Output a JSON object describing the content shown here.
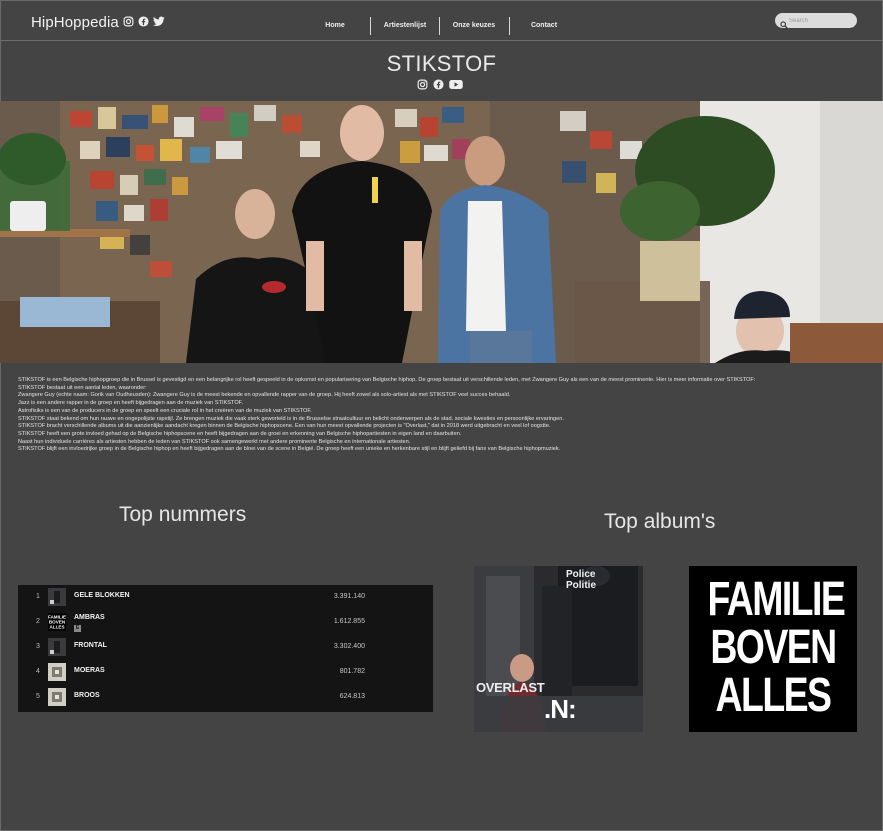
{
  "header": {
    "brand": "HipHoppedia",
    "social": [
      "instagram-icon",
      "facebook-icon",
      "twitter-icon"
    ],
    "nav": [
      {
        "label": "Home"
      },
      {
        "label": "Artiestenlijst"
      },
      {
        "label": "Onze keuzes"
      },
      {
        "label": "Contact"
      }
    ],
    "search": {
      "placeholder": "Search"
    }
  },
  "artist": {
    "name": "STIKSTOF",
    "social": [
      "instagram-icon",
      "facebook-icon",
      "youtube-icon"
    ]
  },
  "bio": [
    "STIKSTOF is een Belgische hiphopgroep die in Brussel is gevestigd en een belangrijke rol heeft gespeeld in de opkomst en popularisering van Belgische hiphop. De groep bestaat uit verschillende leden, met Zwangere Guy als een van de meest prominente. Hier is meer informatie over STIKSTOF:",
    "STIKSTOF bestaat uit een aantal leden, waaronder:",
    "Zwangere Guy (echte naam: Gorik van Oudheusden): Zwangere Guy is de meest bekende en opvallende rapper van de groep. Hij heeft zowel als solo-artiest als met STIKSTOF veel succes behaald.",
    "Jazz is een andere rapper in de groep en heeft bijgedragen aan de muziek van STIKSTOF.",
    "Astrofisiks is een van de producers in de groep en speelt een cruciale rol in het creëren van de muziek van STIKSTOF.",
    "STIKSTOF staat bekend om hun rauwe en ongepolijste rapstijl. Ze brengen muziek die vaak sterk geworteld is in de Brusselse straatcultuur en belicht onderwerpen als de stad, sociale kwesties en persoonlijke ervaringen.",
    "STIKSTOF bracht verschillende albums uit die aanzienlijke aandacht kregen binnen de Belgische hiphopscene. Een van hun meest opvallende projecten is \"Overlast,\" dat in 2018 werd uitgebracht en veel lof oogstte.",
    "STIKSTOF heeft een grote invloed gehad op de Belgische hiphopscene en heeft bijgedragen aan de groei en erkenning van Belgische hiphopartiesten in eigen land en daarbuiten.",
    "Naast hun individuele carrières als artiesten hebben de leden van STIKSTOF ook samengewerkt met andere prominente Belgische en internationale artiesten.",
    "STIKSTOF blijft een invloedrijke groep in de Belgische hiphop en heeft bijgedragen aan de bloei van de scene in België. De groep heeft een unieke en herkenbare stijl en blijft geliefd bij fans van Belgische hiphopmuziek."
  ],
  "top_tracks": {
    "title": "Top nummers",
    "items": [
      {
        "rank": "1",
        "title": "GELE BLOKKEN",
        "plays": "3.391.140",
        "explicit": false,
        "art": "dark"
      },
      {
        "rank": "2",
        "title": "AMBRAS",
        "plays": "1.612.855",
        "explicit": true,
        "badge": "E",
        "art": "familie"
      },
      {
        "rank": "3",
        "title": "FRONTAL",
        "plays": "3.302.400",
        "explicit": false,
        "art": "dark"
      },
      {
        "rank": "4",
        "title": "MOERAS",
        "plays": "801.782",
        "explicit": false,
        "art": "light"
      },
      {
        "rank": "5",
        "title": "BROOS",
        "plays": "624.813",
        "explicit": false,
        "art": "light"
      }
    ]
  },
  "top_albums": {
    "title": "Top album's",
    "items": [
      {
        "name": "overlast",
        "cover_text": "OVERLAST",
        "sign_line1": "Police",
        "sign_line2": "Politie",
        "logo": ".N:"
      },
      {
        "name": "familie-boven-alles",
        "cover_lines": [
          "FAMILIE",
          "BOVEN",
          "ALLES"
        ]
      }
    ]
  },
  "colors": {
    "background": "#444444",
    "text": "#e8e8e8",
    "panel": "#141414"
  }
}
